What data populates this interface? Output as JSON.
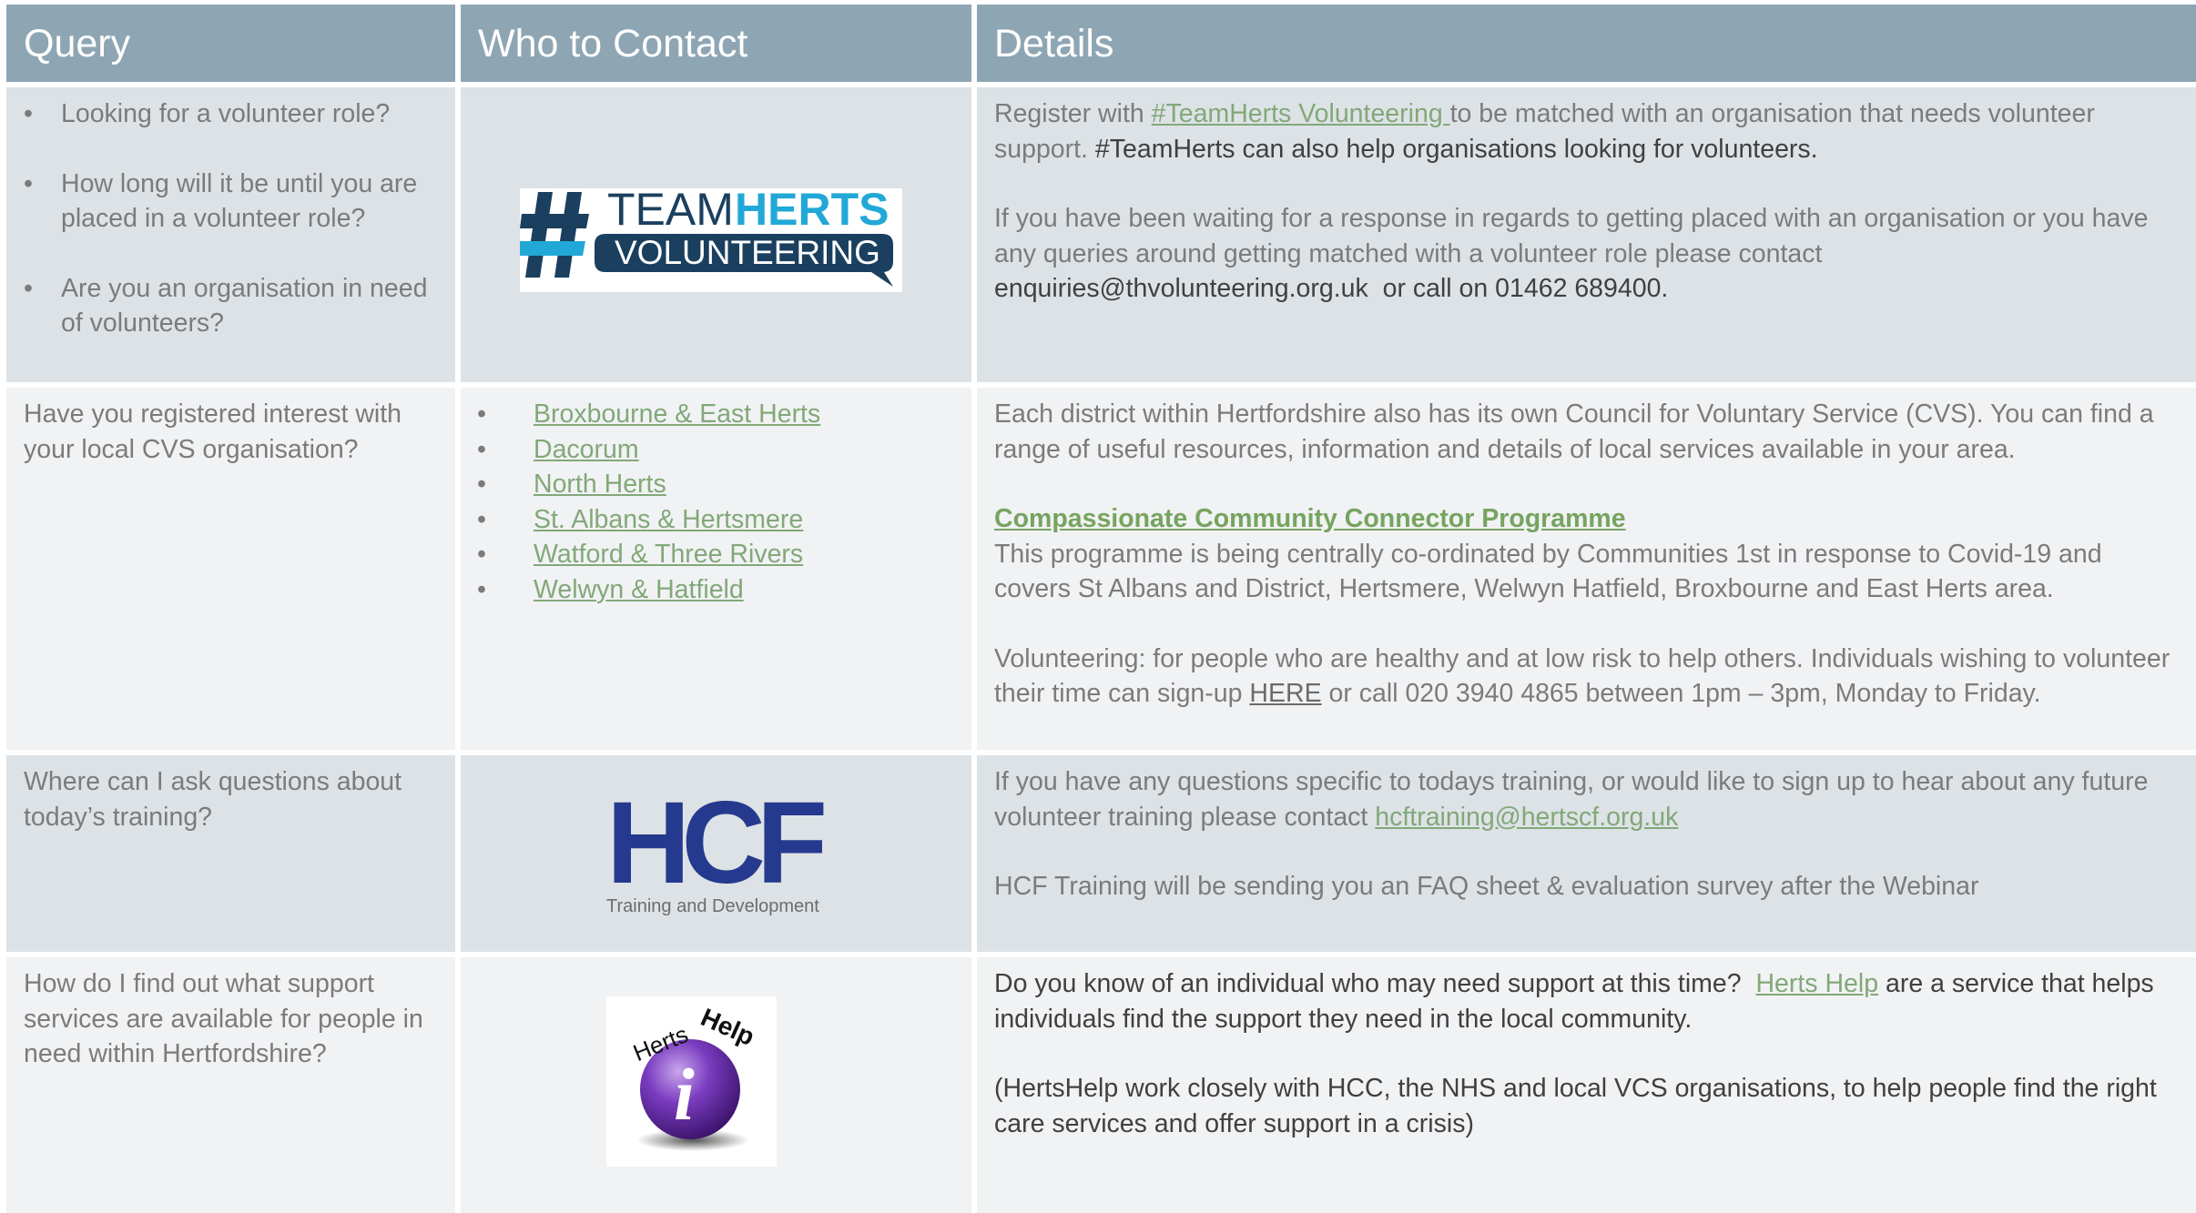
{
  "headers": {
    "query": "Query",
    "contact": "Who to Contact",
    "details": "Details"
  },
  "row1": {
    "queries": [
      "Looking for a volunteer role?",
      "How long will it be until you are placed in a volunteer role?",
      "Are you an organisation in need of volunteers?"
    ],
    "logo": {
      "team": "TEAM",
      "herts": "HERTS",
      "volunteering": "VOLUNTEERING",
      "colors": {
        "navy": "#1b3f5e",
        "cyan": "#22a8d6"
      }
    },
    "p1_pre": "Register with ",
    "p1_link": "#TeamHerts Volunteering ",
    "p1_post": "to be matched with an organisation that needs volunteer support.",
    "p1_dark": " #TeamHerts can also help organisations looking for volunteers.",
    "p2": "If you have been waiting for a response in regards to getting placed with an organisation or you have any queries around getting matched with a volunteer role please contact",
    "p2_email": "enquiries@thvolunteering.org.uk",
    "p2_phone": "  or call on 01462 689400."
  },
  "row2": {
    "query": "Have you registered interest with your local CVS organisation?",
    "links": [
      "Broxbourne & East Herts",
      "Dacorum",
      "North Herts",
      "St. Albans & Hertsmere",
      "Watford & Three Rivers",
      "Welwyn & Hatfield"
    ],
    "d1": "Each district within Hertfordshire also has its own Council for Voluntary Service (CVS). You can find a range of useful resources, information and details of local services available in your area.",
    "d2_title": "Compassionate Community Connector Programme",
    "d2_body": "This programme is being centrally co-ordinated by Communities 1st in response to Covid-19 and covers St Albans and District, Hertsmere, Welwyn Hatfield, Broxbourne and East Herts area.",
    "d3_pre": "Volunteering: for people who are healthy and at low risk to help others.  Individuals wishing to volunteer their time can sign-up ",
    "d3_here": "HERE",
    "d3_post": " or call 020 3940 4865 between 1pm – 3pm, Monday to Friday."
  },
  "row3": {
    "query": "Where can I ask questions about today’s training?",
    "logo": {
      "text": "HCF",
      "sub": "Training and Development",
      "color": "#253a8e"
    },
    "d1_pre": "If you have any questions specific to todays training, or would like to sign up to hear about any future volunteer training please contact ",
    "d1_email": "hcftraining@hertscf.org.uk",
    "d2": "HCF Training will be sending you an FAQ sheet & evaluation survey after the Webinar"
  },
  "row4": {
    "query": "How do I find out what support services are available for people in need within Hertfordshire?",
    "logo": {
      "herts": "Herts",
      "help": "Help",
      "i": "i"
    },
    "d1_pre": "Do you know of an individual who may need support at this time?  ",
    "d1_link": "Herts Help",
    "d1_post": " are a service that helps individuals find the support they need in the local community.",
    "d2": "(HertsHelp work closely with HCC, the NHS and local VCS organisations, to help people find the right care services and offer support in a crisis)"
  }
}
